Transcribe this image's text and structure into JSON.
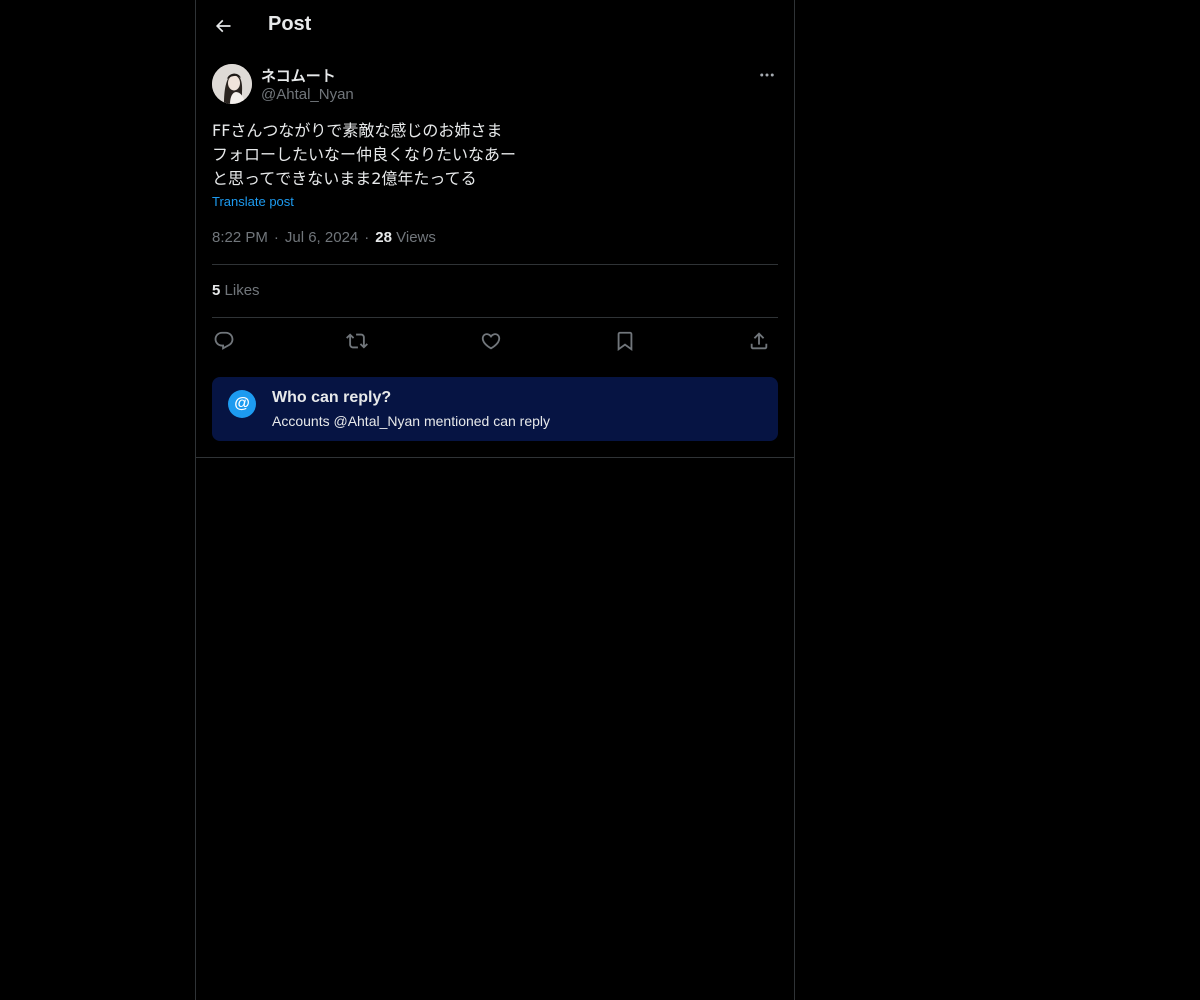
{
  "header": {
    "title": "Post"
  },
  "author": {
    "display_name": "ネコムート",
    "handle": "@Ahtal_Nyan"
  },
  "post": {
    "lines": [
      "FFさんつながりで素敵な感じのお姉さま",
      "フォローしたいなー仲良くなりたいなあー",
      "と思ってできないまま2億年たってる"
    ],
    "translate_label": "Translate post",
    "time": "8:22 PM",
    "date": "Jul 6, 2024",
    "views_count": "28",
    "views_label": "Views",
    "likes_count": "5",
    "likes_label": "Likes"
  },
  "icons": {
    "back": "arrow-left-icon",
    "more": "more-horizontal-icon",
    "reply": "reply-icon",
    "repost": "repost-icon",
    "like": "heart-icon",
    "bookmark": "bookmark-icon",
    "share": "share-icon",
    "mention": "at-icon"
  },
  "reply_restriction": {
    "symbol": "@",
    "title": "Who can reply?",
    "description": "Accounts @Ahtal_Nyan mentioned can reply"
  },
  "colors": {
    "background": "#000000",
    "text": "#e7e9ea",
    "muted": "#71767b",
    "accent": "#1d9bf0",
    "reply_box": "#061443",
    "border": "#2f3336"
  }
}
